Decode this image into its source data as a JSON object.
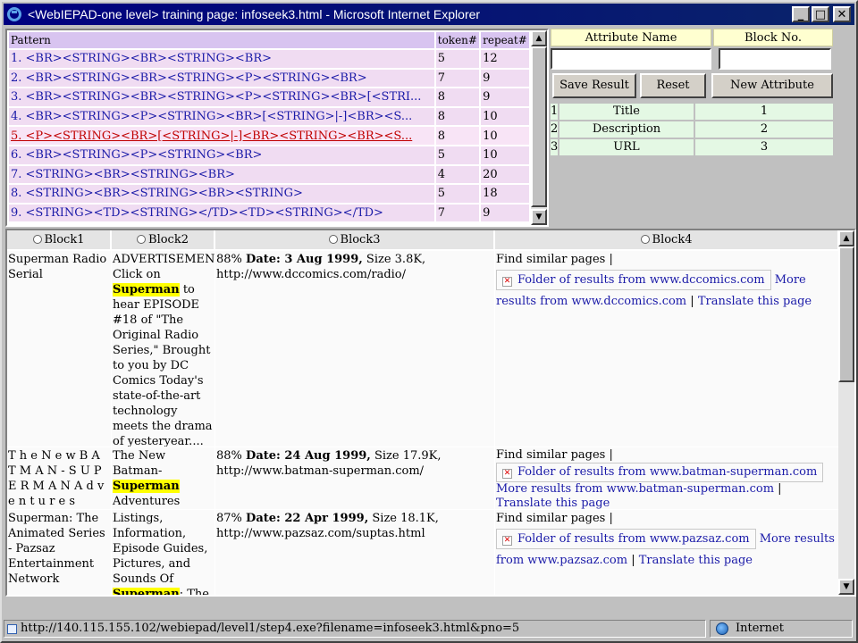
{
  "window": {
    "title": "<WebIEPAD-one level> training page: infoseek3.html - Microsoft Internet Explorer",
    "minimize_glyph": "_",
    "maximize_glyph": "□",
    "close_glyph": "✕"
  },
  "pattern_table": {
    "headers": {
      "pattern": "Pattern",
      "token": "token#",
      "repeat": "repeat#"
    },
    "rows": [
      {
        "pattern": "1. <BR><STRING><BR><STRING><BR>",
        "token": "5",
        "repeat": "12"
      },
      {
        "pattern": "2. <BR><STRING><BR><STRING><P><STRING><BR>",
        "token": "7",
        "repeat": "9"
      },
      {
        "pattern": "3. <BR><STRING><BR><STRING><P><STRING><BR>[<STRI...",
        "token": "8",
        "repeat": "9"
      },
      {
        "pattern": "4. <BR><STRING><P><STRING><BR>[<STRING>|-]<BR><S...",
        "token": "8",
        "repeat": "10"
      },
      {
        "pattern": "5. <P><STRING><BR>[<STRING>|-]<BR><STRING><BR><S...",
        "token": "8",
        "repeat": "10"
      },
      {
        "pattern": "6. <BR><STRING><P><STRING><BR>",
        "token": "5",
        "repeat": "10"
      },
      {
        "pattern": "7. <STRING><BR><STRING><BR>",
        "token": "4",
        "repeat": "20"
      },
      {
        "pattern": "8. <STRING><BR><STRING><BR><STRING>",
        "token": "5",
        "repeat": "18"
      },
      {
        "pattern": "9. <STRING><TD><STRING></TD><TD><STRING></TD>",
        "token": "7",
        "repeat": "9"
      }
    ]
  },
  "attribute_panel": {
    "header_name": "Attribute Name",
    "header_block": "Block No.",
    "name_input_value": "",
    "block_input_value": "",
    "save_label": "Save Result",
    "reset_label": "Reset",
    "new_label": "New Attribute",
    "rows": [
      {
        "idx": "1",
        "name": "Title",
        "block": "1"
      },
      {
        "idx": "2",
        "name": "Description",
        "block": "2"
      },
      {
        "idx": "3",
        "name": "URL",
        "block": "3"
      }
    ]
  },
  "blocks": {
    "headers": [
      "Block1",
      "Block2",
      "Block3",
      "Block4"
    ],
    "rows": [
      {
        "b1": "Superman Radio Serial",
        "b2_pre": "ADVERTISEMENT Click on ",
        "b2_hl": "Superman",
        "b2_post": " to hear EPISODE #18 of \"The Original Radio Series,\" Brought to you by DC Comics Today's state-of-the-art technology meets the drama of yesteryear.... as Warner Bros.Online and DC Comics ...",
        "b3_pct": "88%",
        "b3_date": "Date: 3 Aug 1999,",
        "b3_size": "Size 3.8K,",
        "b3_url": "http://www.dccomics.com/radio/",
        "b4_similar": "Find similar pages",
        "b4_folder": "Folder of results from www.dccomics.com",
        "b4_more": "More results from www.dccomics.com",
        "b4_translate": "Translate this page"
      },
      {
        "b1": "T h e N e w B A T M A N - S U P E R M A N A d v e n t u r e s",
        "b2_pre": "The New Batman-",
        "b2_hl": "Superman",
        "b2_post": " Adventures Official Site",
        "b3_pct": "88%",
        "b3_date": "Date: 24 Aug 1999,",
        "b3_size": "Size 17.9K,",
        "b3_url": "http://www.batman-superman.com/",
        "b4_similar": "Find similar pages",
        "b4_folder": "Folder of results from www.batman-superman.com",
        "b4_more": "More results from www.batman-superman.com",
        "b4_translate": "Translate this page"
      },
      {
        "b1": "Superman: The Animated Series - Pazsaz Entertainment Network",
        "b2_pre": "Listings, Information, Episode Guides, Pictures, and Sounds Of ",
        "b2_hl": "Superman",
        "b2_post": ": The Animated Series.",
        "b3_pct": "87%",
        "b3_date": "Date: 22 Apr 1999,",
        "b3_size": "Size 18.1K,",
        "b3_url": "http://www.pazsaz.com/suptas.html",
        "b4_similar": "Find similar pages",
        "b4_folder": "Folder of results from www.pazsaz.com",
        "b4_more": "More results from www.pazsaz.com",
        "b4_translate": "Translate this page"
      }
    ]
  },
  "status_bar": {
    "url": "http://140.115.155.102/webiepad/level1/step4.exe?filename=infoseek3.html&pno=5",
    "zone": "Internet"
  },
  "icons": {
    "app": "ie-logo-icon",
    "scroll_up": "▲",
    "scroll_down": "▼",
    "separator": "|",
    "broken_image": "✕"
  }
}
